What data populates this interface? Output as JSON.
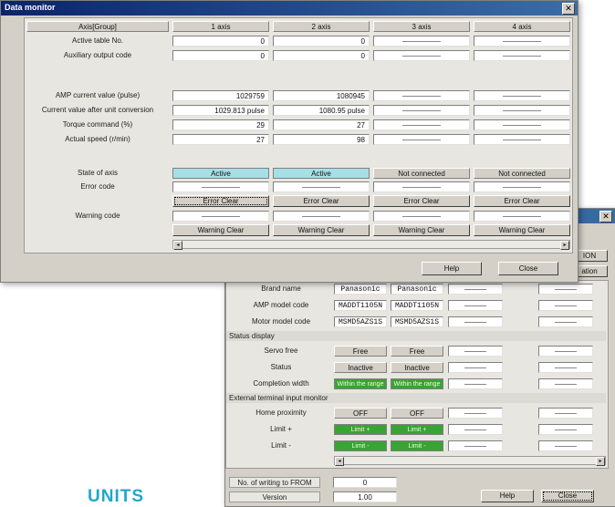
{
  "window1": {
    "title": "Data monitor",
    "axis_header": "Axis[Group]",
    "axes": [
      "1 axis",
      "2 axis",
      "3 axis",
      "4 axis"
    ],
    "rows1": [
      {
        "label": "Active table No.",
        "values": [
          "0",
          "0"
        ]
      },
      {
        "label": "Auxiliary output code",
        "values": [
          "0",
          "0"
        ]
      }
    ],
    "rows2": [
      {
        "label": "AMP current value (pulse)",
        "values": [
          "1029759",
          "1080945"
        ]
      },
      {
        "label": "Current value after unit conversion",
        "values": [
          "1029.813 pulse",
          "1080.95 pulse"
        ]
      },
      {
        "label": "Torque command (%)",
        "values": [
          "29",
          "27"
        ]
      },
      {
        "label": "Actual speed (r/min)",
        "values": [
          "27",
          "98"
        ]
      }
    ],
    "state_label": "State of axis",
    "states": [
      "Active",
      "Active",
      "Not connected",
      "Not connected"
    ],
    "error_code_label": "Error code",
    "error_clear": "Error Clear",
    "warning_code_label": "Warning code",
    "warning_clear": "Warning Clear",
    "help": "Help",
    "close": "Close"
  },
  "window2": {
    "top_buttons": [
      "ION",
      "ation"
    ],
    "rows_a": [
      {
        "label": "Brand name",
        "values": [
          "Panasonic",
          "Panasonic"
        ]
      },
      {
        "label": "AMP model code",
        "values": [
          "MADDT1105N",
          "MADDT1105N"
        ]
      },
      {
        "label": "Motor model code",
        "values": [
          "MSMD5AZS1S",
          "MSMD5AZS1S"
        ]
      }
    ],
    "section_status": "Status display",
    "servo_label": "Servo free",
    "servo_values": [
      "Free",
      "Free"
    ],
    "status_label": "Status",
    "status_values": [
      "Inactive",
      "Inactive"
    ],
    "completion_label": "Completion width",
    "completion_values": [
      "Within the range",
      "Within the range"
    ],
    "section_external": "External terminal input monitor",
    "home_label": "Home proximity",
    "home_values": [
      "OFF",
      "OFF"
    ],
    "limit_plus_label": "Limit +",
    "limit_plus_values": [
      "Limit +",
      "Limit +"
    ],
    "limit_minus_label": "Limit -",
    "limit_minus_values": [
      "Limit -",
      "Limit -"
    ],
    "fram_label": "No. of writing to FROM",
    "fram_value": "0",
    "version_label": "Version",
    "version_value": "1.00",
    "help": "Help",
    "close": "Close"
  },
  "page_text": "UNITS"
}
